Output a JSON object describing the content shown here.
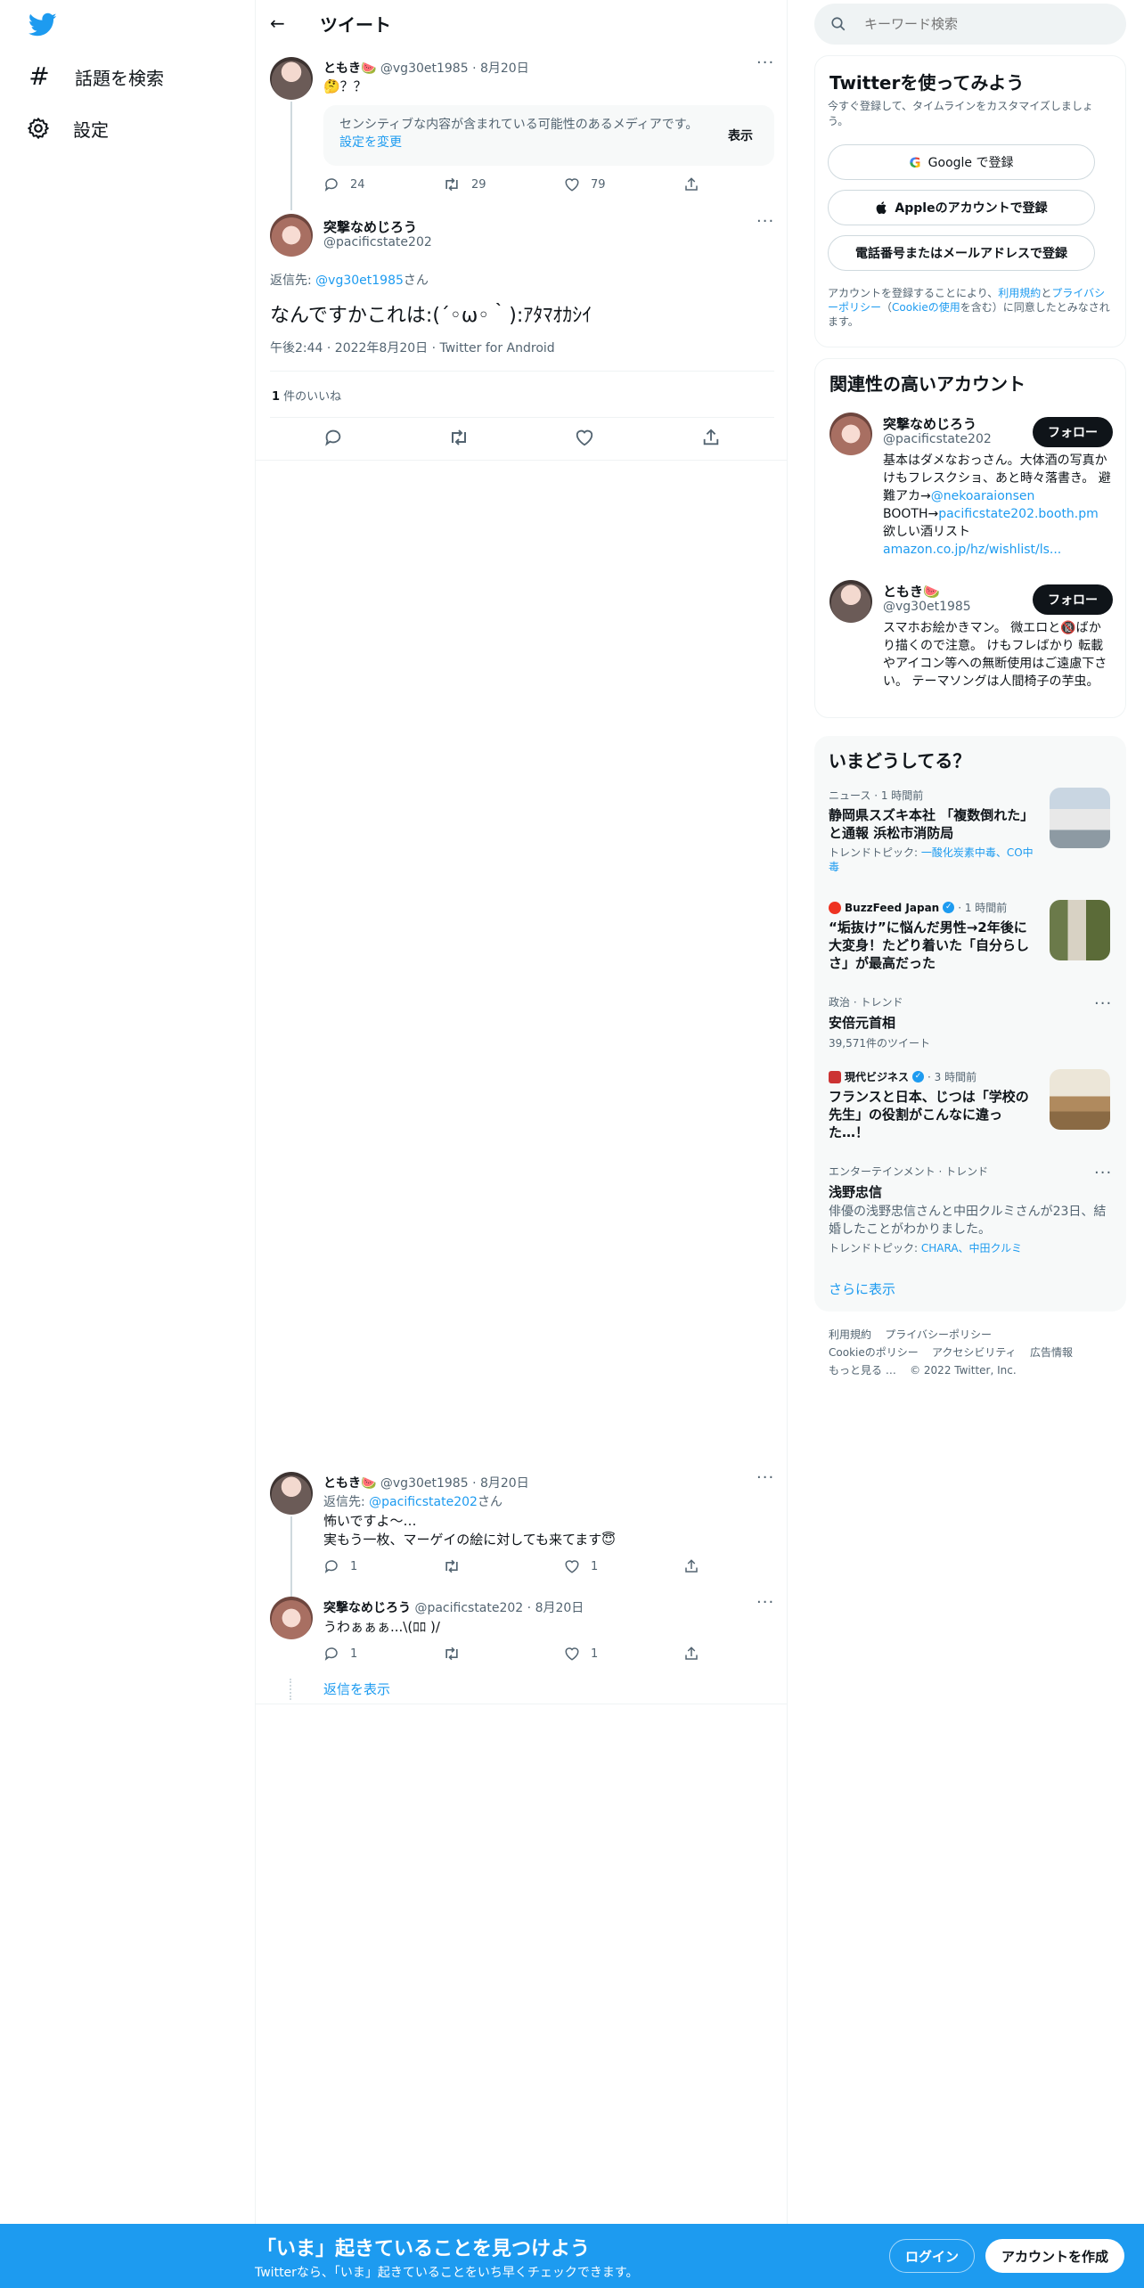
{
  "nav": {
    "explore_label": "話題を検索",
    "settings_label": "設定"
  },
  "header": {
    "title": "ツイート"
  },
  "tweet1": {
    "name": "ともき🍉",
    "handle": "@vg30et1985",
    "date": "8月20日",
    "text": "🤔？？",
    "sensitive_text": "センシティブな内容が含まれている可能性のあるメディアです。",
    "sensitive_link": "設定を変更",
    "show_label": "表示",
    "replies": "24",
    "retweets": "29",
    "likes": "79"
  },
  "main_tweet": {
    "name": "突撃なめじろう",
    "handle": "@pacificstate202",
    "reply_to_prefix": "返信先: ",
    "reply_to_handle": "@vg30et1985",
    "reply_to_suffix": "さん",
    "text": "なんですかこれは:(´◦ω◦｀):ｱﾀﾏｵｶｼｲ",
    "time": "午後2:44 · 2022年8月20日 · Twitter for Android",
    "likes_count": "1",
    "likes_label": " 件のいいね"
  },
  "reply1": {
    "name": "ともき🍉",
    "handle": "@vg30et1985",
    "date": "8月20日",
    "reply_to_prefix": "返信先: ",
    "reply_to_handle": "@pacificstate202",
    "reply_to_suffix": "さん",
    "line1": "怖いですよ〜…",
    "line2": "実もう一枚、マーゲイの絵に対しても来てます😇",
    "replies": "1",
    "likes": "1"
  },
  "reply2": {
    "name": "突撃なめじろう",
    "handle": "@pacificstate202",
    "date": "8月20日",
    "text": "うわぁぁぁ...\\(ﾛﾛ )/",
    "replies": "1",
    "likes": "1",
    "show_replies": "返信を表示"
  },
  "search": {
    "placeholder": "キーワード検索"
  },
  "signup": {
    "title": "Twitterを使ってみよう",
    "subtitle": "今すぐ登録して、タイムラインをカスタマイズしましょう。",
    "google_label": "Google で登録",
    "apple_label": "Appleのアカウントで登録",
    "phone_label": "電話番号またはメールアドレスで登録",
    "terms_1": "アカウントを登録することにより、",
    "terms_link1": "利用規約",
    "terms_2": "と",
    "terms_link2": "プライバシーポリシー",
    "terms_3": "（",
    "terms_link3": "Cookieの使用",
    "terms_4": "を含む）に同意したとみなされます。"
  },
  "related": {
    "title": "関連性の高いアカウント",
    "follow_label": "フォロー",
    "accounts": [
      {
        "name": "突撃なめじろう",
        "handle": "@pacificstate202",
        "bio1": "基本はダメなおっさん。大体酒の写真かけもフレスクショ、あと時々落書き。 避難アカ→",
        "bio_link1": "@nekoaraionsen",
        "bio2": "BOOTH→",
        "bio_link2": "pacificstate202.booth.pm",
        "bio3": "欲しい酒リスト",
        "bio_link3": "amazon.co.jp/hz/wishlist/ls..."
      },
      {
        "name": "ともき🍉",
        "handle": "@vg30et1985",
        "bio": "スマホお絵かきマン。 微エロと🔞ばかり描くので注意。 けもフレばかり 転載やアイコン等への無断使用はご遠慮下さい。 テーマソングは人間椅子の芋虫。"
      }
    ]
  },
  "trends": {
    "title": "いまどうしてる？",
    "items": [
      {
        "meta": "ニュース · 1 時間前",
        "title": "静岡県スズキ本社 「複数倒れた」と通報 浜松市消防局",
        "topic_prefix": "トレンドトピック: ",
        "topic": "一酸化炭素中毒、CO中毒"
      },
      {
        "source": "BuzzFeed Japan",
        "meta": " · 1 時間前",
        "title": "“垢抜け”に悩んだ男性→2年後に大変身！たどり着いた「自分らしさ」が最高だった"
      },
      {
        "meta": "政治 · トレンド",
        "title": "安倍元首相",
        "count": "39,571件のツイート"
      },
      {
        "source": "現代ビジネス",
        "meta": " · 3 時間前",
        "title": "フランスと日本、じつは「学校の先生」の役割がこんなに違った…！"
      },
      {
        "meta": "エンターテインメント · トレンド",
        "title": "浅野忠信",
        "desc": "俳優の浅野忠信さんと中田クルミさんが23日、結婚したことがわかりました。",
        "topic_prefix": "トレンドトピック: ",
        "topic": "CHARA、中田クルミ"
      }
    ],
    "show_more": "さらに表示"
  },
  "footer": {
    "links": [
      "利用規約",
      "プライバシーポリシー",
      "Cookieのポリシー",
      "アクセシビリティ",
      "広告情報",
      "もっと見る …"
    ],
    "copyright": "© 2022 Twitter, Inc."
  },
  "bottom_bar": {
    "title": "「いま」起きていることを見つけよう",
    "subtitle": "Twitterなら、「いま」起きていることをいち早くチェックできます。",
    "login_label": "ログイン",
    "signup_label": "アカウントを作成"
  },
  "colors": {
    "accent": "#1d9bf0",
    "text": "#0f1419",
    "muted": "#536471"
  }
}
